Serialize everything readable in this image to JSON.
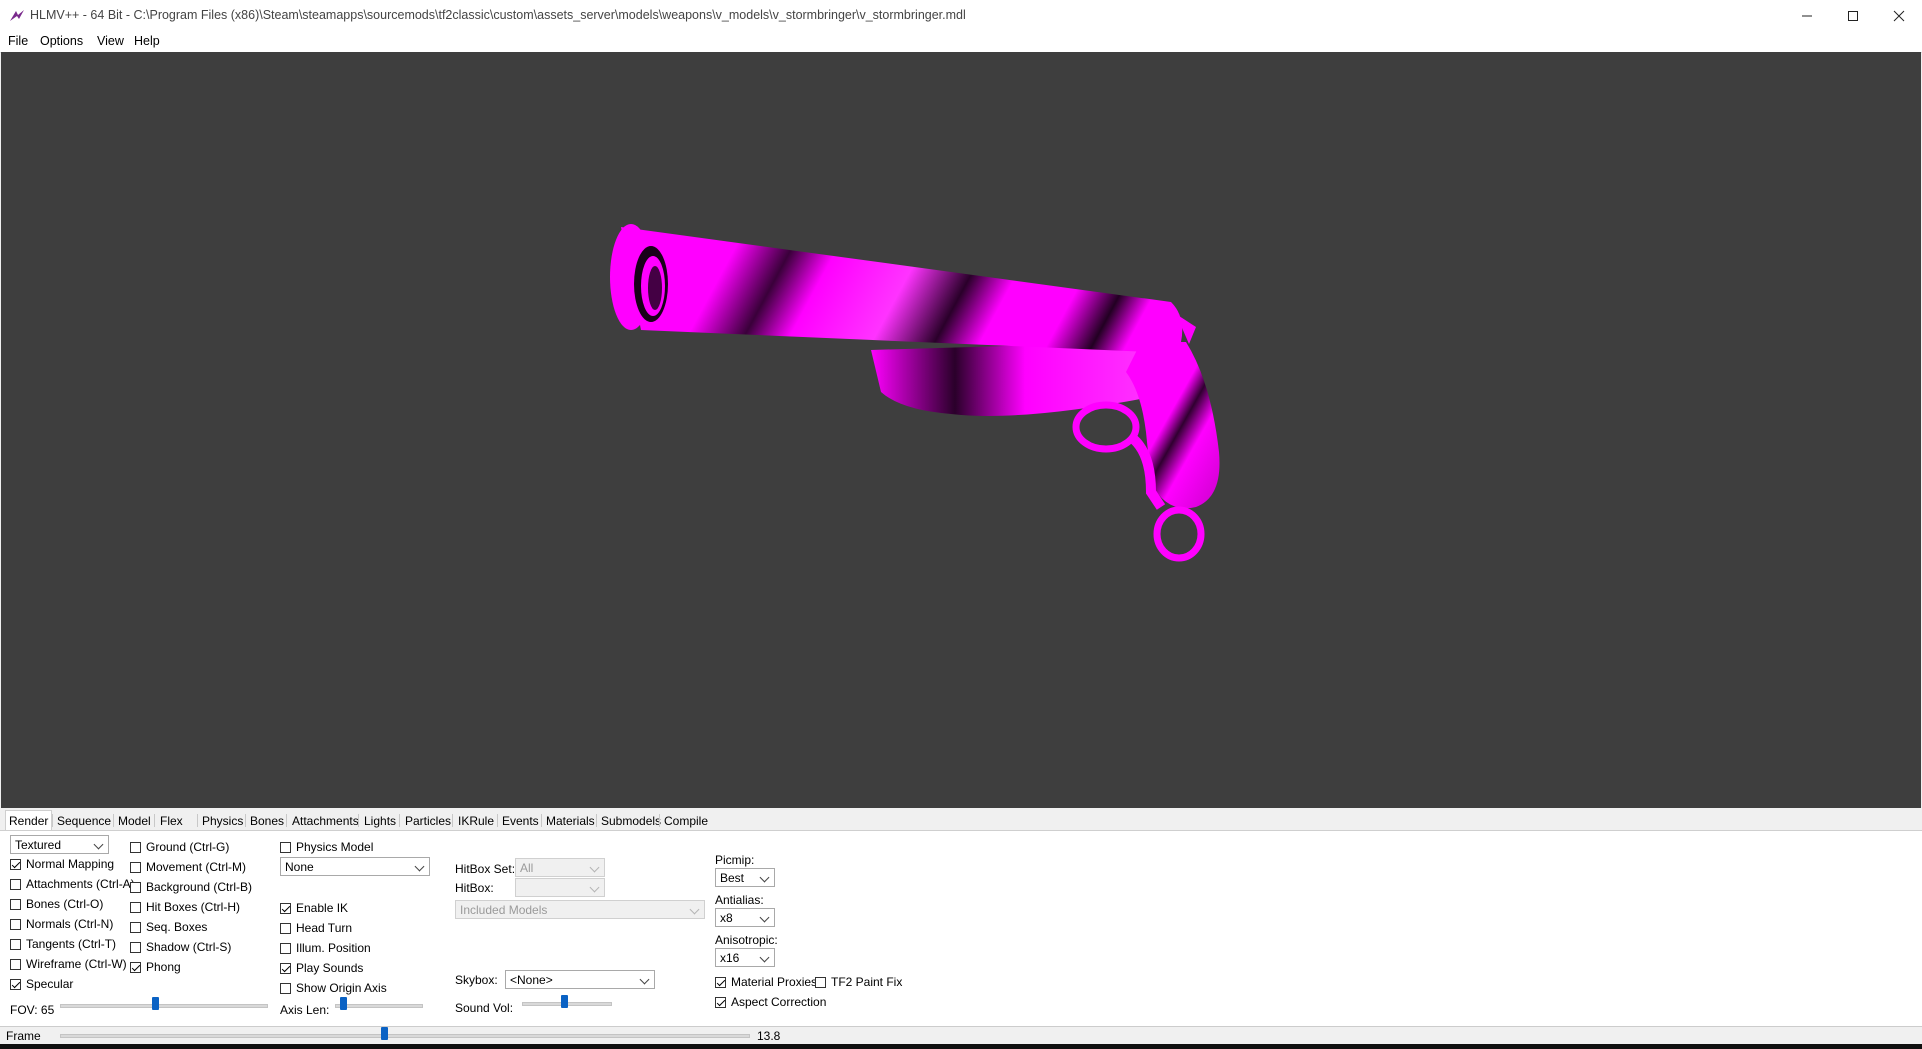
{
  "window": {
    "title": "HLMV++ - 64 Bit - C:\\Program Files (x86)\\Steam\\steamapps\\sourcemods\\tf2classic\\custom\\assets_server\\models\\weapons\\v_models\\v_stormbringer\\v_stormbringer.mdl",
    "icons": {
      "app": "hlmv-app-icon",
      "minimize": "minimize-icon",
      "maximize": "maximize-icon",
      "close": "close-icon"
    }
  },
  "menu": [
    "File",
    "Options",
    "View",
    "Help"
  ],
  "viewport": {
    "background": "#3e3e3e",
    "model_color": "#ff00ff"
  },
  "tabs": [
    "Render",
    "Sequence",
    "Model",
    "Flex",
    "Physics",
    "Bones",
    "Attachments",
    "Lights",
    "Particles",
    "IKRule",
    "Events",
    "Materials",
    "Submodels",
    "Compile"
  ],
  "active_tab": "Render",
  "render": {
    "render_mode": "Textured",
    "col1": [
      {
        "label": "Normal Mapping",
        "checked": true
      },
      {
        "label": "Attachments (Ctrl-A)",
        "checked": false
      },
      {
        "label": "Bones (Ctrl-O)",
        "checked": false
      },
      {
        "label": "Normals (Ctrl-N)",
        "checked": false
      },
      {
        "label": "Tangents (Ctrl-T)",
        "checked": false
      },
      {
        "label": "Wireframe (Ctrl-W)",
        "checked": false
      },
      {
        "label": "Specular",
        "checked": true
      }
    ],
    "col2": [
      {
        "label": "Ground (Ctrl-G)",
        "checked": false
      },
      {
        "label": "Movement (Ctrl-M)",
        "checked": false
      },
      {
        "label": "Background (Ctrl-B)",
        "checked": false
      },
      {
        "label": "Hit Boxes (Ctrl-H)",
        "checked": false
      },
      {
        "label": "Seq. Boxes",
        "checked": false
      },
      {
        "label": "Shadow (Ctrl-S)",
        "checked": false
      },
      {
        "label": "Phong",
        "checked": true
      }
    ],
    "physics_model": {
      "label": "Physics Model",
      "checked": false
    },
    "physics_select": "None",
    "col3": [
      {
        "label": "Enable IK",
        "checked": true
      },
      {
        "label": "Head Turn",
        "checked": false
      },
      {
        "label": "Illum. Position",
        "checked": false
      },
      {
        "label": "Play Sounds",
        "checked": true
      },
      {
        "label": "Show Origin Axis",
        "checked": false
      }
    ],
    "fov_label": "FOV: 65",
    "fov_level": 0.46,
    "axis_len_label": "Axis Len:",
    "axis_len_level": 0.06,
    "hitbox_set_label": "HitBox Set:",
    "hitbox_set_value": "All",
    "hitbox_label": "HitBox:",
    "hitbox_value": "",
    "included_models": "Included Models",
    "skybox_label": "Skybox:",
    "skybox_value": "<None>",
    "sound_vol_label": "Sound Vol:",
    "sound_vol_level": 0.47,
    "picmip_label": "Picmip:",
    "picmip_value": "Best",
    "antialias_label": "Antialias:",
    "antialias_value": "x8",
    "anisotropic_label": "Anisotropic:",
    "anisotropic_value": "x16",
    "material_proxies": {
      "label": "Material Proxies",
      "checked": true
    },
    "tf2_paint_fix": {
      "label": "TF2 Paint Fix",
      "checked": false
    },
    "aspect_correction": {
      "label": "Aspect Correction",
      "checked": true
    }
  },
  "frame": {
    "label": "Frame",
    "value": "13.8",
    "level": 0.47
  },
  "accent": "#0a62c4"
}
